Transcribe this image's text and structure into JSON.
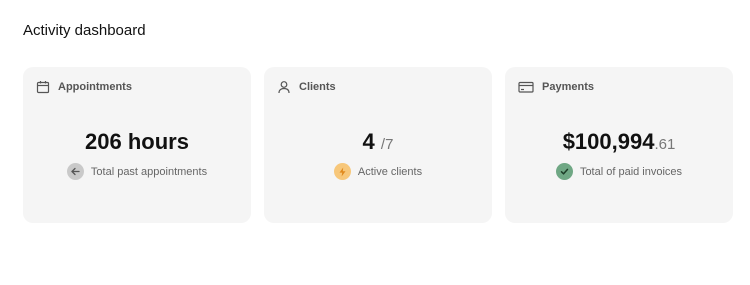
{
  "page": {
    "title": "Activity dashboard"
  },
  "cards": [
    {
      "label": "Appointments",
      "icon": "calendar-icon",
      "value": "206 hours",
      "caption": "Total past appointments",
      "badge_icon": "arrow-left-icon",
      "badge_color": "#c9c9c9"
    },
    {
      "label": "Clients",
      "icon": "user-icon",
      "value": "4",
      "value_suffix": "/7",
      "caption": "Active clients",
      "badge_icon": "lightning-icon",
      "badge_color": "#f7c77a"
    },
    {
      "label": "Payments",
      "icon": "credit-card-icon",
      "value": "$100,994",
      "value_cents": ".61",
      "caption": "Total of paid invoices",
      "badge_icon": "check-icon",
      "badge_color": "#6fa784"
    }
  ]
}
